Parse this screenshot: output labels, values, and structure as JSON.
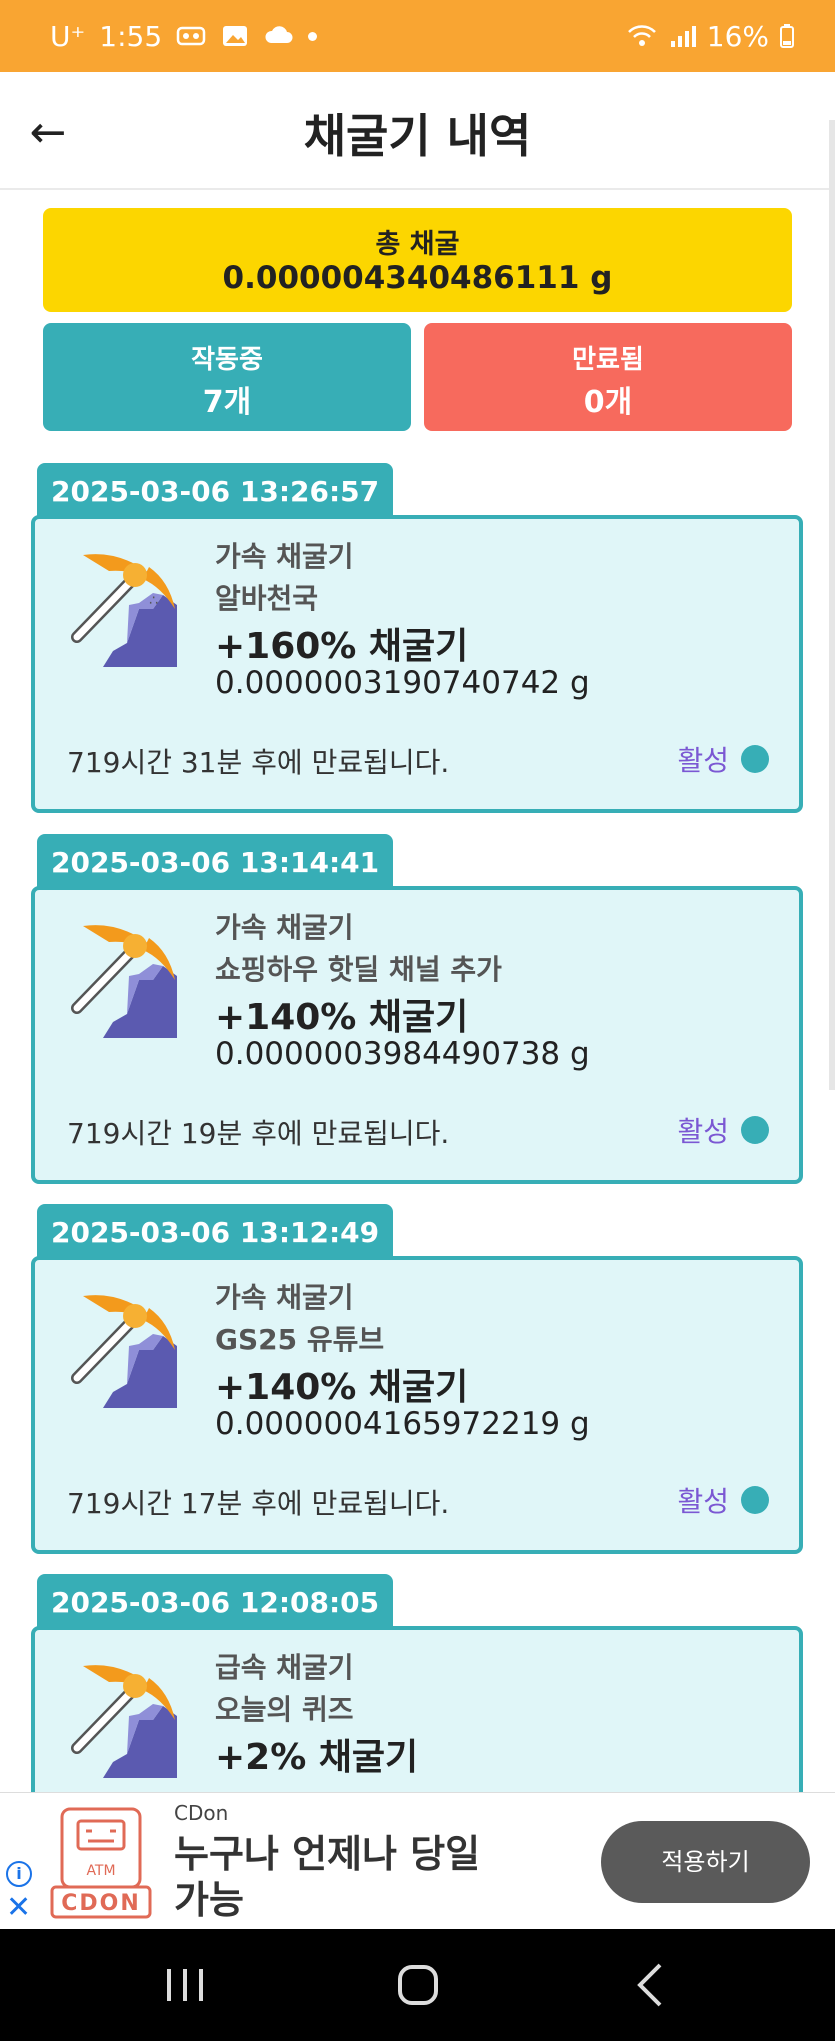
{
  "status_bar": {
    "carrier": "U⁺",
    "time": "1:55",
    "battery": "16%"
  },
  "header": {
    "back_icon": "←",
    "title": "채굴기 내역"
  },
  "summary": {
    "total_label": "총 채굴",
    "total_value": "0.000004340486111 g",
    "active_label": "작동중",
    "active_count": "7개",
    "expired_label": "만료됨",
    "expired_count": "0개"
  },
  "miners": [
    {
      "date": "2025-03-06 13:26:57",
      "type": "가속 채굴기",
      "source": "알바천국",
      "boost": "+160% 채굴기",
      "amount": "0.0000003190740742 g",
      "expire": "719시간 31분 후에 만료됩니다.",
      "status": "활성"
    },
    {
      "date": "2025-03-06 13:14:41",
      "type": "가속 채굴기",
      "source": "쇼핑하우 핫딜 채널 추가",
      "boost": "+140% 채굴기",
      "amount": "0.0000003984490738 g",
      "expire": "719시간 19분 후에 만료됩니다.",
      "status": "활성"
    },
    {
      "date": "2025-03-06 13:12:49",
      "type": "가속 채굴기",
      "source": "GS25 유튜브",
      "boost": "+140% 채굴기",
      "amount": "0.0000004165972219 g",
      "expire": "719시간 17분 후에 만료됩니다.",
      "status": "활성"
    },
    {
      "date": "2025-03-06 12:08:05",
      "type": "급속 채굴기",
      "source": "오늘의 퀴즈",
      "boost": "+2% 채굴기"
    }
  ],
  "ad": {
    "brand": "CDon",
    "logo_top": "ATM",
    "logo_bottom": "CDON",
    "text": "누구나 언제나 당일 가능",
    "button": "적용하기",
    "info_icon": "i",
    "close_icon": "✕"
  },
  "colors": {
    "status_bar": "#f9a532",
    "total": "#fcd600",
    "active": "#37aeb6",
    "expired": "#f76a5d",
    "status_text": "#7b58d3"
  }
}
